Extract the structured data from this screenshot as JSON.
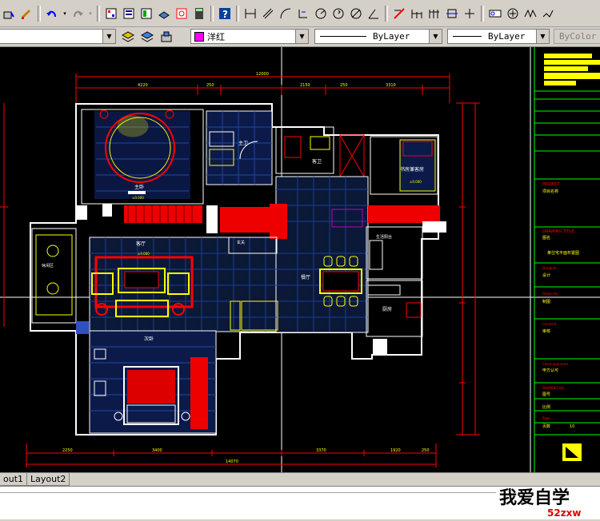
{
  "toolbar2": {
    "color_value": "洋红",
    "color_swatch": "#ff00ff",
    "linetype_value": "ByLayer",
    "lineweight_value": "ByLayer",
    "plotstyle_value": "ByColor"
  },
  "tabs": [
    {
      "label": "out1"
    },
    {
      "label": "Layout2"
    }
  ],
  "watermark": {
    "text": "我爱自学",
    "url": "52zxw"
  },
  "drawing": {
    "dims_top": [
      "12000",
      "4220",
      "250",
      "2150",
      "3310",
      "250"
    ],
    "dims_bottom": [
      "14070",
      "2250",
      "3400",
      "3370",
      "1920",
      "250"
    ],
    "room_labels": [
      "主卧",
      "客厅",
      "餐厅",
      "主卫",
      "客卫",
      "厨房",
      "次卧",
      "书房兼客房",
      "生活阳台",
      "休闲区",
      "玄关"
    ],
    "level": "±0.000",
    "title_block": {
      "project": "PROJECT",
      "project_cn": "项目名称",
      "drawing_title": "DRAWING TITLE",
      "drawing_cn": "图名",
      "drawing_name": "某住宅平面布置图",
      "designer": "Designer",
      "designer_cn": "设计",
      "drawn": "Drawn By",
      "drawn_cn": "制图",
      "check": "Checked",
      "check_cn": "审核",
      "approved": "Client approved",
      "approved_cn": "甲方认可",
      "dwg_no": "DRAWING NO",
      "dwg_no_cn": "图号",
      "scale_cn": "比例",
      "page": "Page",
      "page_cn": "页数",
      "page_val": "10"
    }
  }
}
